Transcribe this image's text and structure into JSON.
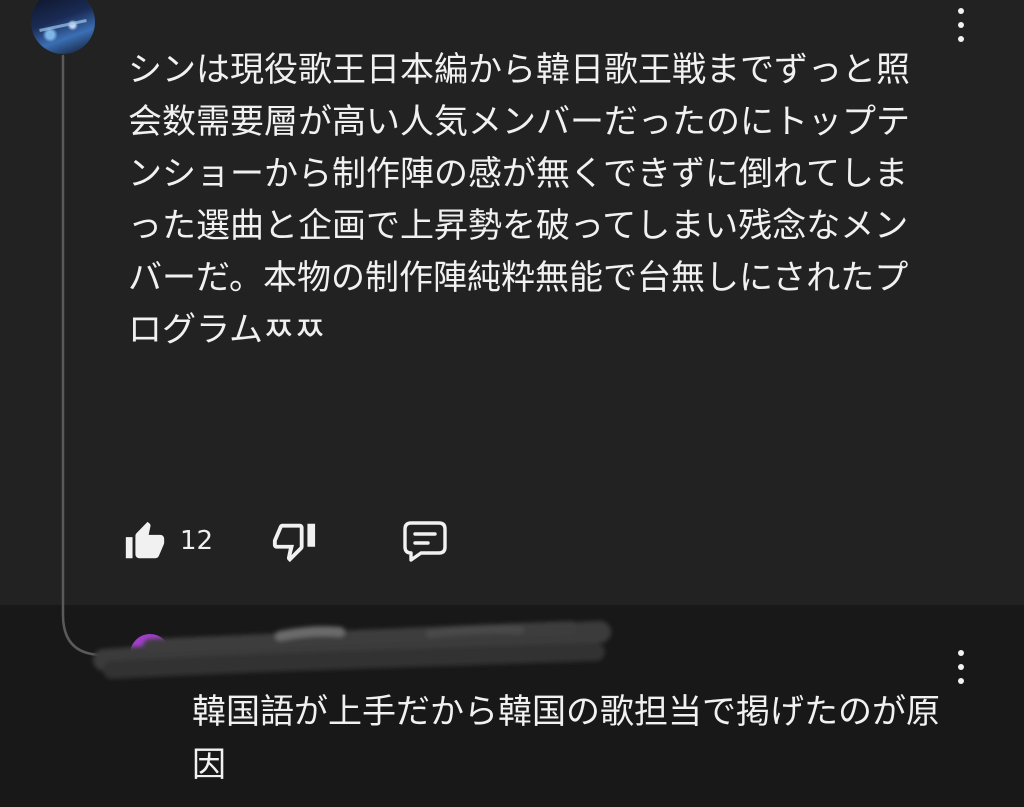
{
  "colors": {
    "comment_background": "#222222",
    "reply_background": "#181818",
    "text": "#f1f1f1",
    "thread_line": "#5a5a5a",
    "reply_avatar": "#a23fcb"
  },
  "comment": {
    "avatar_icon": "avatar-icon",
    "menu_icon": "more-vert-icon",
    "body_lines": [
      "シンは現役歌王日本編から韓日歌王戦までずっと照",
      "会数需要層が高い人気メンバーだったのにトップテ",
      "ンショーから制作陣の感が無くできずに倒れてしま",
      "った選曲と企画で上昇勢を破ってしまい残念なメン",
      "バーだ。本物の制作陣純粋無能で台無しにされたプ",
      "ログラムㅉㅉ"
    ],
    "like_count": "12",
    "icons": {
      "like": "thumbs-up-filled-icon",
      "dislike": "thumbs-down-icon",
      "reply": "comment-icon"
    }
  },
  "reply": {
    "avatar_icon": "avatar-icon",
    "menu_icon": "more-vert-icon",
    "username_redacted": true,
    "body_lines": [
      "韓国語が上手だから韓国の歌担当で掲げたのが原",
      "因"
    ]
  }
}
